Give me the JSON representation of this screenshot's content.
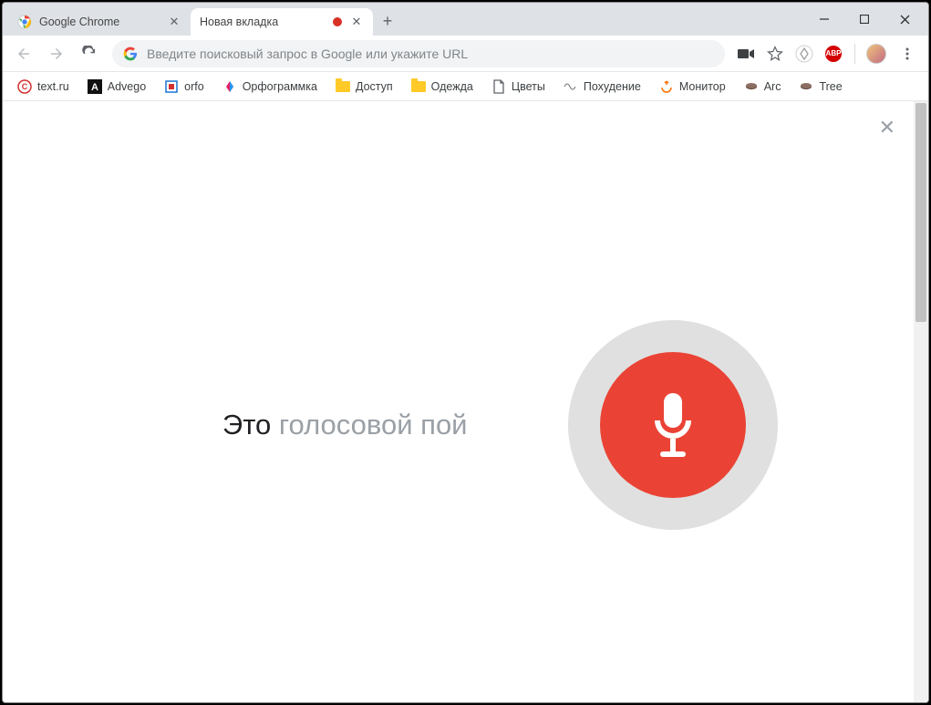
{
  "tabs": [
    {
      "title": "Google Chrome",
      "active": false
    },
    {
      "title": "Новая вкладка",
      "active": true
    }
  ],
  "omnibox": {
    "placeholder": "Введите поисковый запрос в Google или укажите URL"
  },
  "toolbar_ext": {
    "abp_label": "ABP"
  },
  "bookmarks": [
    {
      "label": "text.ru"
    },
    {
      "label": "Advego"
    },
    {
      "label": "orfo"
    },
    {
      "label": "Орфограммка"
    },
    {
      "label": "Доступ"
    },
    {
      "label": "Одежда"
    },
    {
      "label": "Цветы"
    },
    {
      "label": "Похудение"
    },
    {
      "label": "Монитор"
    },
    {
      "label": "Arc"
    },
    {
      "label": "Tree"
    }
  ],
  "voice": {
    "text_dark": "Это",
    "text_light": " голосовой пой"
  }
}
